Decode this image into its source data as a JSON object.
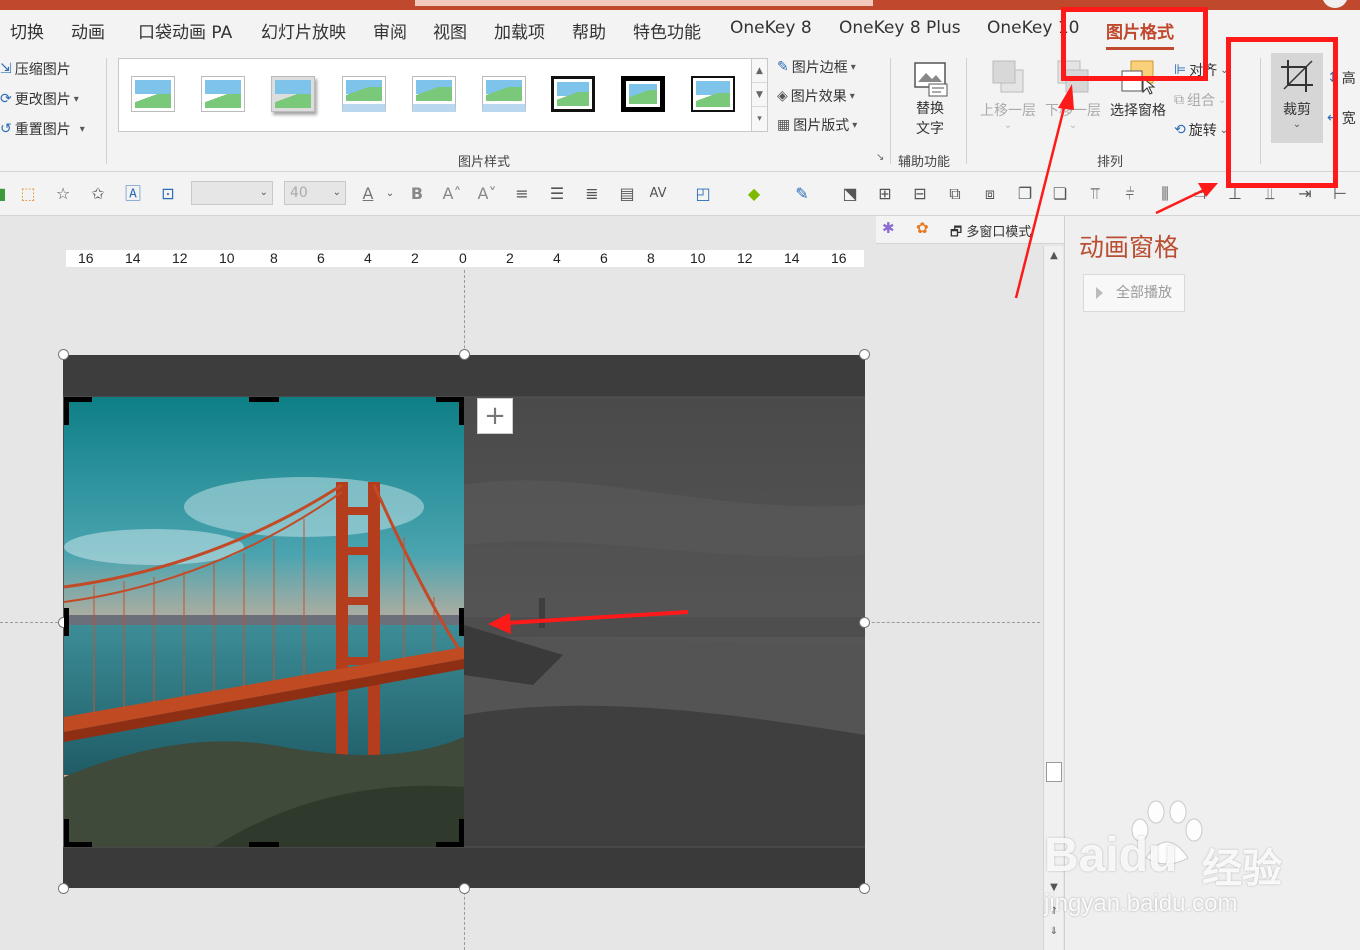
{
  "menu": {
    "tabs": [
      {
        "label": "切换"
      },
      {
        "label": "动画"
      },
      {
        "label": "口袋动画 PA"
      },
      {
        "label": "幻灯片放映"
      },
      {
        "label": "审阅"
      },
      {
        "label": "视图"
      },
      {
        "label": "加载项"
      },
      {
        "label": "帮助"
      },
      {
        "label": "特色功能"
      },
      {
        "label": "OneKey 8"
      },
      {
        "label": "OneKey 8 Plus"
      },
      {
        "label": "OneKey 10"
      },
      {
        "label": "图片格式"
      }
    ],
    "active_tab": "图片格式"
  },
  "ribbon": {
    "adjust": {
      "compress": "压缩图片",
      "change": "更改图片",
      "reset": "重置图片"
    },
    "picture_styles": {
      "group_label": "图片样式",
      "border": "图片边框",
      "effects": "图片效果",
      "layout": "图片版式"
    },
    "accessibility": {
      "alt_text_line1": "替换",
      "alt_text_line2": "文字",
      "group_label": "辅助功能"
    },
    "arrange": {
      "bring_forward": "上移一层",
      "send_backward": "下移一层",
      "selection_pane": "选择窗格",
      "align": "对齐",
      "group": "组合",
      "rotate": "旋转",
      "group_label": "排列"
    },
    "size": {
      "crop": "裁剪",
      "height_partial": "高",
      "width_partial": "宽"
    }
  },
  "quick_toolbar": {
    "font_size": "40"
  },
  "panel_bar": {
    "multi_window": "多窗口模式"
  },
  "ruler": {
    "labels": [
      "16",
      "14",
      "12",
      "10",
      "8",
      "6",
      "4",
      "2",
      "0",
      "2",
      "4",
      "6",
      "8",
      "10",
      "12",
      "14",
      "16"
    ]
  },
  "animation_pane": {
    "title": "动画窗格",
    "play_all": "全部播放"
  },
  "watermark": {
    "brand": "Baidu",
    "brand_cn": "经验",
    "url": "jingyan.baidu.com"
  },
  "colors": {
    "accent": "#c0482d",
    "annotation_red": "#ff1a1a"
  }
}
